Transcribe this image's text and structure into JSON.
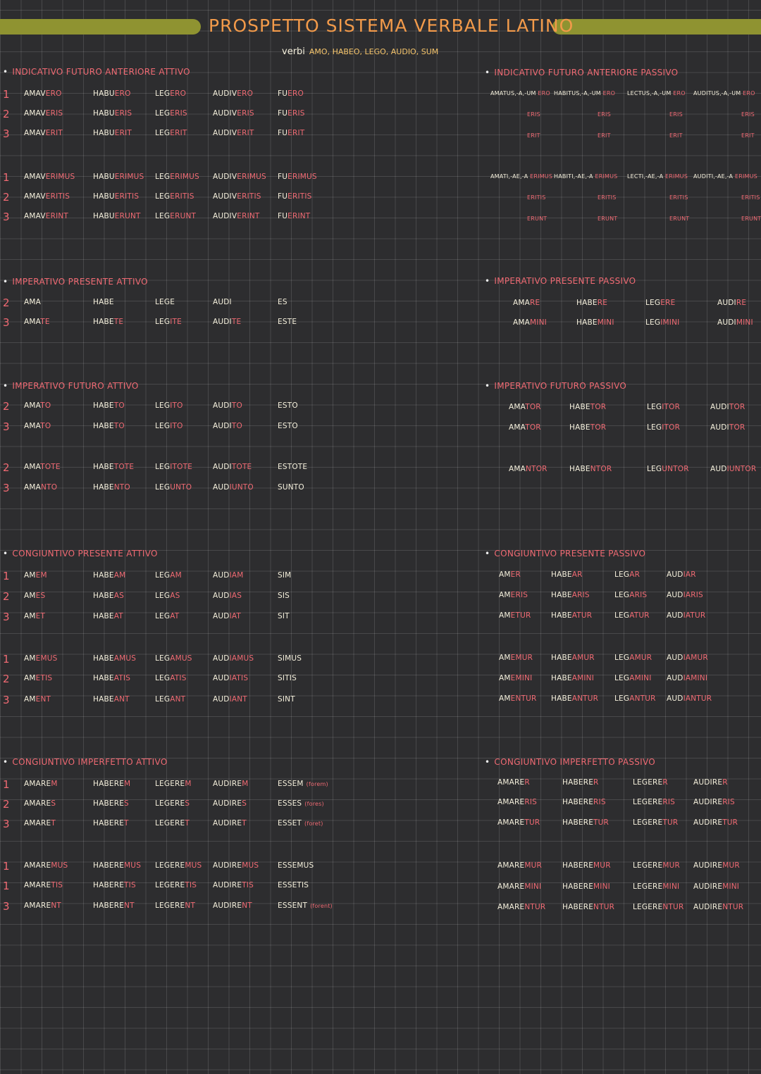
{
  "title": "PROSPETTO SISTEMA VERBALE LATINO",
  "subtitle": {
    "label": "verbi",
    "verbs": "AMO, HABEO, LEGO, AUDIO, SUM"
  },
  "colors": {
    "background": "#2d2d2f",
    "accent_bar": "#8f9331",
    "title": "#f29a4a",
    "ending": "#f06a73",
    "stem": "#f5f0dc"
  },
  "active": {
    "ind_fut_ant": {
      "label": "INDICATIVO FUTURO ANTERIORE ATTIVO",
      "rows": [
        {
          "num": "1",
          "cells": [
            [
              "AMAV",
              "ERO"
            ],
            [
              "HABU",
              "ERO"
            ],
            [
              "LEG",
              "ERO"
            ],
            [
              "AUDIV",
              "ERO"
            ],
            [
              "FU",
              "ERO"
            ]
          ]
        },
        {
          "num": "2",
          "cells": [
            [
              "AMAV",
              "ERIS"
            ],
            [
              "HABU",
              "ERIS"
            ],
            [
              "LEG",
              "ERIS"
            ],
            [
              "AUDIV",
              "ERIS"
            ],
            [
              "FU",
              "ERIS"
            ]
          ]
        },
        {
          "num": "3",
          "cells": [
            [
              "AMAV",
              "ERIT"
            ],
            [
              "HABU",
              "ERIT"
            ],
            [
              "LEG",
              "ERIT"
            ],
            [
              "AUDIV",
              "ERIT"
            ],
            [
              "FU",
              "ERIT"
            ]
          ]
        },
        {
          "num": "1",
          "cells": [
            [
              "AMAV",
              "ERIMUS"
            ],
            [
              "HABU",
              "ERIMUS"
            ],
            [
              "LEG",
              "ERIMUS"
            ],
            [
              "AUDIV",
              "ERIMUS"
            ],
            [
              "FU",
              "ERIMUS"
            ]
          ]
        },
        {
          "num": "2",
          "cells": [
            [
              "AMAV",
              "ERITIS"
            ],
            [
              "HABU",
              "ERITIS"
            ],
            [
              "LEG",
              "ERITIS"
            ],
            [
              "AUDIV",
              "ERITIS"
            ],
            [
              "FU",
              "ERITIS"
            ]
          ]
        },
        {
          "num": "3",
          "cells": [
            [
              "AMAV",
              "ERINT"
            ],
            [
              "HABU",
              "ERUNT"
            ],
            [
              "LEG",
              "ERUNT"
            ],
            [
              "AUDIV",
              "ERINT"
            ],
            [
              "FU",
              "ERINT"
            ]
          ]
        }
      ]
    },
    "imp_pres": {
      "label": "IMPERATIVO PRESENTE ATTIVO",
      "rows": [
        {
          "num": "2",
          "cells": [
            [
              "AMA",
              ""
            ],
            [
              "HABE",
              ""
            ],
            [
              "LEGE",
              ""
            ],
            [
              "AUDI",
              ""
            ],
            [
              "ES",
              ""
            ]
          ]
        },
        {
          "num": "3",
          "cells": [
            [
              "AMA",
              "TE"
            ],
            [
              "HABE",
              "TE"
            ],
            [
              "LEG",
              "ITE"
            ],
            [
              "AUDI",
              "TE"
            ],
            [
              "ESTE",
              ""
            ]
          ]
        }
      ]
    },
    "imp_fut": {
      "label": "IMPERATIVO FUTURO ATTIVO",
      "rows": [
        {
          "num": "2",
          "cells": [
            [
              "AMA",
              "TO"
            ],
            [
              "HABE",
              "TO"
            ],
            [
              "LEG",
              "ITO"
            ],
            [
              "AUDI",
              "TO"
            ],
            [
              "ESTO",
              ""
            ]
          ]
        },
        {
          "num": "3",
          "cells": [
            [
              "AMA",
              "TO"
            ],
            [
              "HABE",
              "TO"
            ],
            [
              "LEG",
              "ITO"
            ],
            [
              "AUDI",
              "TO"
            ],
            [
              "ESTO",
              ""
            ]
          ]
        },
        {
          "num": "2",
          "cells": [
            [
              "AMA",
              "TOTE"
            ],
            [
              "HABE",
              "TOTE"
            ],
            [
              "LEG",
              "ITOTE"
            ],
            [
              "AUDI",
              "TOTE"
            ],
            [
              "ESTOTE",
              ""
            ]
          ]
        },
        {
          "num": "3",
          "cells": [
            [
              "AMA",
              "NTO"
            ],
            [
              "HABE",
              "NTO"
            ],
            [
              "LEG",
              "UNTO"
            ],
            [
              "AUD",
              "IUNTO"
            ],
            [
              "SUNTO",
              ""
            ]
          ]
        }
      ]
    },
    "cong_pres": {
      "label": "CONGIUNTIVO PRESENTE ATTIVO",
      "rows": [
        {
          "num": "1",
          "cells": [
            [
              "AM",
              "EM"
            ],
            [
              "HABE",
              "AM"
            ],
            [
              "LEG",
              "AM"
            ],
            [
              "AUD",
              "IAM"
            ],
            [
              "SIM",
              ""
            ]
          ]
        },
        {
          "num": "2",
          "cells": [
            [
              "AM",
              "ES"
            ],
            [
              "HABE",
              "AS"
            ],
            [
              "LEG",
              "AS"
            ],
            [
              "AUD",
              "IAS"
            ],
            [
              "SIS",
              ""
            ]
          ]
        },
        {
          "num": "3",
          "cells": [
            [
              "AM",
              "ET"
            ],
            [
              "HABE",
              "AT"
            ],
            [
              "LEG",
              "AT"
            ],
            [
              "AUD",
              "IAT"
            ],
            [
              "SIT",
              ""
            ]
          ]
        },
        {
          "num": "1",
          "cells": [
            [
              "AM",
              "EMUS"
            ],
            [
              "HABE",
              "AMUS"
            ],
            [
              "LEG",
              "AMUS"
            ],
            [
              "AUD",
              "IAMUS"
            ],
            [
              "SIMUS",
              ""
            ]
          ]
        },
        {
          "num": "2",
          "cells": [
            [
              "AM",
              "ETIS"
            ],
            [
              "HABE",
              "ATIS"
            ],
            [
              "LEG",
              "ATIS"
            ],
            [
              "AUD",
              "IATIS"
            ],
            [
              "SITIS",
              ""
            ]
          ]
        },
        {
          "num": "3",
          "cells": [
            [
              "AM",
              "ENT"
            ],
            [
              "HABE",
              "ANT"
            ],
            [
              "LEG",
              "ANT"
            ],
            [
              "AUD",
              "IANT"
            ],
            [
              "SINT",
              ""
            ]
          ]
        }
      ]
    },
    "cong_imperf": {
      "label": "CONGIUNTIVO IMPERFETTO ATTIVO",
      "rows": [
        {
          "num": "1",
          "cells": [
            [
              "AMARE",
              "M"
            ],
            [
              "HABERE",
              "M"
            ],
            [
              "LEGERE",
              "M"
            ],
            [
              "AUDIRE",
              "M"
            ],
            [
              "ESSEM",
              "(forem)"
            ]
          ]
        },
        {
          "num": "2",
          "cells": [
            [
              "AMARE",
              "S"
            ],
            [
              "HABERE",
              "S"
            ],
            [
              "LEGERE",
              "S"
            ],
            [
              "AUDIRE",
              "S"
            ],
            [
              "ESSES",
              "(fores)"
            ]
          ]
        },
        {
          "num": "3",
          "cells": [
            [
              "AMARE",
              "T"
            ],
            [
              "HABERE",
              "T"
            ],
            [
              "LEGERE",
              "T"
            ],
            [
              "AUDIRE",
              "T"
            ],
            [
              "ESSET",
              "(foret)"
            ]
          ]
        },
        {
          "num": "1",
          "cells": [
            [
              "AMARE",
              "MUS"
            ],
            [
              "HABERE",
              "MUS"
            ],
            [
              "LEGERE",
              "MUS"
            ],
            [
              "AUDIRE",
              "MUS"
            ],
            [
              "ESSEMUS",
              ""
            ]
          ]
        },
        {
          "num": "1",
          "cells": [
            [
              "AMARE",
              "TIS"
            ],
            [
              "HABERE",
              "TIS"
            ],
            [
              "LEGERE",
              "TIS"
            ],
            [
              "AUDIRE",
              "TIS"
            ],
            [
              "ESSETIS",
              ""
            ]
          ]
        },
        {
          "num": "3",
          "cells": [
            [
              "AMARE",
              "NT"
            ],
            [
              "HABERE",
              "NT"
            ],
            [
              "LEGERE",
              "NT"
            ],
            [
              "AUDIRE",
              "NT"
            ],
            [
              "ESSENT",
              "(forent)"
            ]
          ]
        }
      ]
    }
  },
  "passive": {
    "ind_fut_ant": {
      "label": "INDICATIVO FUTURO ANTERIORE PASSIVO",
      "rows": [
        {
          "cells": [
            [
              "AMATUS,-A,-UM ",
              "ERO"
            ],
            [
              "HABITUS,-A,-UM ",
              "ERO"
            ],
            [
              "LECTUS,-A,-UM ",
              "ERO"
            ],
            [
              "AUDITUS,-A,-UM ",
              "ERO"
            ]
          ]
        },
        {
          "cells": [
            [
              "",
              "ERIS"
            ],
            [
              "",
              "ERIS"
            ],
            [
              "",
              "ERIS"
            ],
            [
              "",
              "ERIS"
            ]
          ]
        },
        {
          "cells": [
            [
              "",
              "ERIT"
            ],
            [
              "",
              "ERIT"
            ],
            [
              "",
              "ERIT"
            ],
            [
              "",
              "ERIT"
            ]
          ]
        },
        {
          "cells": [
            [
              "AMATI,-AE,-A ",
              "ERIMUS"
            ],
            [
              "HABITI,-AE,-A ",
              "ERIMUS"
            ],
            [
              "LECTI,-AE,-A ",
              "ERIMUS"
            ],
            [
              "AUDITI,-AE,-A ",
              "ERIMUS"
            ]
          ]
        },
        {
          "cells": [
            [
              "",
              "ERITIS"
            ],
            [
              "",
              "ERITIS"
            ],
            [
              "",
              "ERITIS"
            ],
            [
              "",
              "ERITIS"
            ]
          ]
        },
        {
          "cells": [
            [
              "",
              "ERUNT"
            ],
            [
              "",
              "ERUNT"
            ],
            [
              "",
              "ERUNT"
            ],
            [
              "",
              "ERUNT"
            ]
          ]
        }
      ]
    },
    "imp_pres": {
      "label": "IMPERATIVO PRESENTE PASSIVO",
      "rows": [
        {
          "cells": [
            [
              "AMA",
              "RE"
            ],
            [
              "HABE",
              "RE"
            ],
            [
              "LEG",
              "ERE"
            ],
            [
              "AUDI",
              "RE"
            ]
          ]
        },
        {
          "cells": [
            [
              "AMA",
              "MINI"
            ],
            [
              "HABE",
              "MINI"
            ],
            [
              "LEG",
              "IMINI"
            ],
            [
              "AUDI",
              "MINI"
            ]
          ]
        }
      ]
    },
    "imp_fut": {
      "label": "IMPERATIVO FUTURO PASSIVO",
      "rows": [
        {
          "cells": [
            [
              "AMA",
              "TOR"
            ],
            [
              "HABE",
              "TOR"
            ],
            [
              "LEG",
              "ITOR"
            ],
            [
              "AUDI",
              "TOR"
            ]
          ]
        },
        {
          "cells": [
            [
              "AMA",
              "TOR"
            ],
            [
              "HABE",
              "TOR"
            ],
            [
              "LEG",
              "ITOR"
            ],
            [
              "AUDI",
              "TOR"
            ]
          ]
        },
        {
          "cells": [
            [
              "AMA",
              "NTOR"
            ],
            [
              "HABE",
              "NTOR"
            ],
            [
              "LEG",
              "UNTOR"
            ],
            [
              "AUD",
              "IUNTOR"
            ]
          ]
        }
      ]
    },
    "cong_pres": {
      "label": "CONGIUNTIVO PRESENTE PASSIVO",
      "rows": [
        {
          "cells": [
            [
              "AM",
              "ER"
            ],
            [
              "HABE",
              "AR"
            ],
            [
              "LEG",
              "AR"
            ],
            [
              "AUD",
              "IAR"
            ]
          ]
        },
        {
          "cells": [
            [
              "AM",
              "ERIS"
            ],
            [
              "HABE",
              "ARIS"
            ],
            [
              "LEG",
              "ARIS"
            ],
            [
              "AUD",
              "IARIS"
            ]
          ]
        },
        {
          "cells": [
            [
              "AM",
              "ETUR"
            ],
            [
              "HABE",
              "ATUR"
            ],
            [
              "LEG",
              "ATUR"
            ],
            [
              "AUD",
              "IATUR"
            ]
          ]
        },
        {
          "cells": [
            [
              "AM",
              "EMUR"
            ],
            [
              "HABE",
              "AMUR"
            ],
            [
              "LEG",
              "AMUR"
            ],
            [
              "AUD",
              "IAMUR"
            ]
          ]
        },
        {
          "cells": [
            [
              "AM",
              "EMINI"
            ],
            [
              "HABE",
              "AMINI"
            ],
            [
              "LEG",
              "AMINI"
            ],
            [
              "AUD",
              "IAMINI"
            ]
          ]
        },
        {
          "cells": [
            [
              "AM",
              "ENTUR"
            ],
            [
              "HABE",
              "ANTUR"
            ],
            [
              "LEG",
              "ANTUR"
            ],
            [
              "AUD",
              "IANTUR"
            ]
          ]
        }
      ]
    },
    "cong_imperf": {
      "label": "CONGIUNTIVO IMPERFETTO PASSIVO",
      "rows": [
        {
          "cells": [
            [
              "AMARE",
              "R"
            ],
            [
              "HABERE",
              "R"
            ],
            [
              "LEGERE",
              "R"
            ],
            [
              "AUDIRE",
              "R"
            ]
          ]
        },
        {
          "cells": [
            [
              "AMARE",
              "RIS"
            ],
            [
              "HABERE",
              "RIS"
            ],
            [
              "LEGERE",
              "RIS"
            ],
            [
              "AUDIRE",
              "RIS"
            ]
          ]
        },
        {
          "cells": [
            [
              "AMARE",
              "TUR"
            ],
            [
              "HABERE",
              "TUR"
            ],
            [
              "LEGERE",
              "TUR"
            ],
            [
              "AUDIRE",
              "TUR"
            ]
          ]
        },
        {
          "cells": [
            [
              "AMARE",
              "MUR"
            ],
            [
              "HABERE",
              "MUR"
            ],
            [
              "LEGERE",
              "MUR"
            ],
            [
              "AUDIRE",
              "MUR"
            ]
          ]
        },
        {
          "cells": [
            [
              "AMARE",
              "MINI"
            ],
            [
              "HABERE",
              "MINI"
            ],
            [
              "LEGERE",
              "MINI"
            ],
            [
              "AUDIRE",
              "MINI"
            ]
          ]
        },
        {
          "cells": [
            [
              "AMARE",
              "NTUR"
            ],
            [
              "HABERE",
              "NTUR"
            ],
            [
              "LEGERE",
              "NTUR"
            ],
            [
              "AUDIRE",
              "NTUR"
            ]
          ]
        }
      ]
    }
  }
}
